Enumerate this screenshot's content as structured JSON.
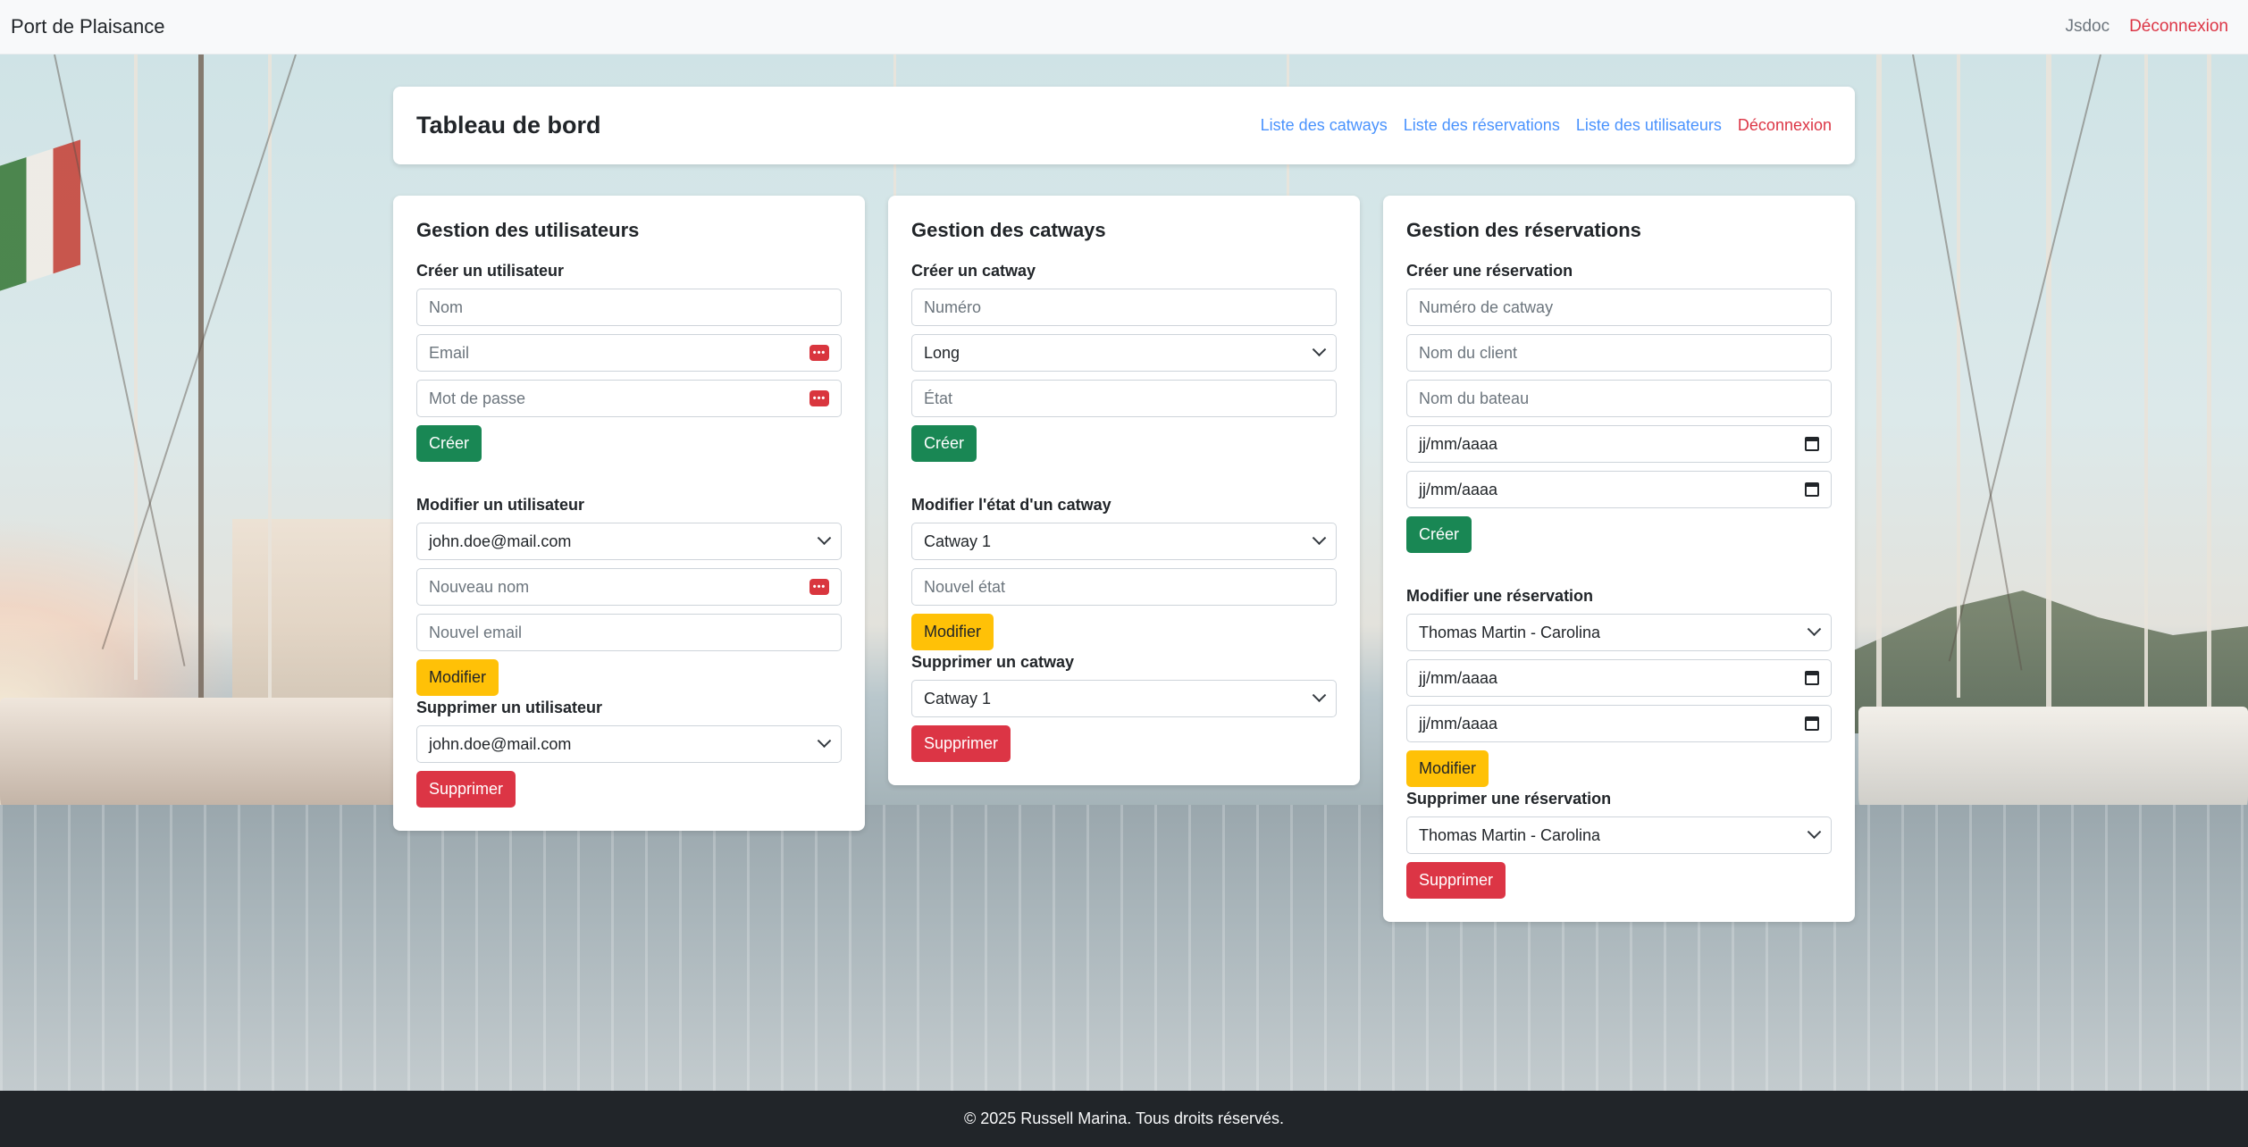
{
  "navbar": {
    "brand": "Port de Plaisance",
    "links": [
      {
        "label": "Jsdoc"
      },
      {
        "label": "Déconnexion"
      }
    ]
  },
  "header": {
    "title": "Tableau de bord",
    "links": [
      {
        "label": "Liste des catways"
      },
      {
        "label": "Liste des réservations"
      },
      {
        "label": "Liste des utilisateurs"
      },
      {
        "label": "Déconnexion"
      }
    ]
  },
  "users": {
    "title": "Gestion des utilisateurs",
    "create": {
      "heading": "Créer un utilisateur",
      "name_placeholder": "Nom",
      "email_placeholder": "Email",
      "password_placeholder": "Mot de passe",
      "button": "Créer"
    },
    "edit": {
      "heading": "Modifier un utilisateur",
      "selected_user": "john.doe@mail.com",
      "new_name_placeholder": "Nouveau nom",
      "new_email_placeholder": "Nouvel email",
      "button": "Modifier"
    },
    "delete": {
      "heading": "Supprimer un utilisateur",
      "selected_user": "john.doe@mail.com",
      "button": "Supprimer"
    }
  },
  "catways": {
    "title": "Gestion des catways",
    "create": {
      "heading": "Créer un catway",
      "number_placeholder": "Numéro",
      "type_selected": "Long",
      "state_placeholder": "État",
      "button": "Créer"
    },
    "edit": {
      "heading": "Modifier l'état d'un catway",
      "selected_catway": "Catway 1",
      "new_state_placeholder": "Nouvel état",
      "button": "Modifier"
    },
    "delete": {
      "heading": "Supprimer un catway",
      "selected_catway": "Catway 1",
      "button": "Supprimer"
    }
  },
  "reservations": {
    "title": "Gestion des réservations",
    "create": {
      "heading": "Créer une réservation",
      "catway_number_placeholder": "Numéro de catway",
      "client_name_placeholder": "Nom du client",
      "boat_name_placeholder": "Nom du bateau",
      "start_date": "jj/mm/aaaa",
      "end_date": "jj/mm/aaaa",
      "button": "Créer"
    },
    "edit": {
      "heading": "Modifier une réservation",
      "selected_reservation": "Thomas Martin - Carolina",
      "start_date": "jj/mm/aaaa",
      "end_date": "jj/mm/aaaa",
      "button": "Modifier"
    },
    "delete": {
      "heading": "Supprimer une réservation",
      "selected_reservation": "Thomas Martin - Carolina",
      "button": "Supprimer"
    }
  },
  "footer": {
    "text": "© 2025 Russell Marina. Tous droits réservés."
  }
}
